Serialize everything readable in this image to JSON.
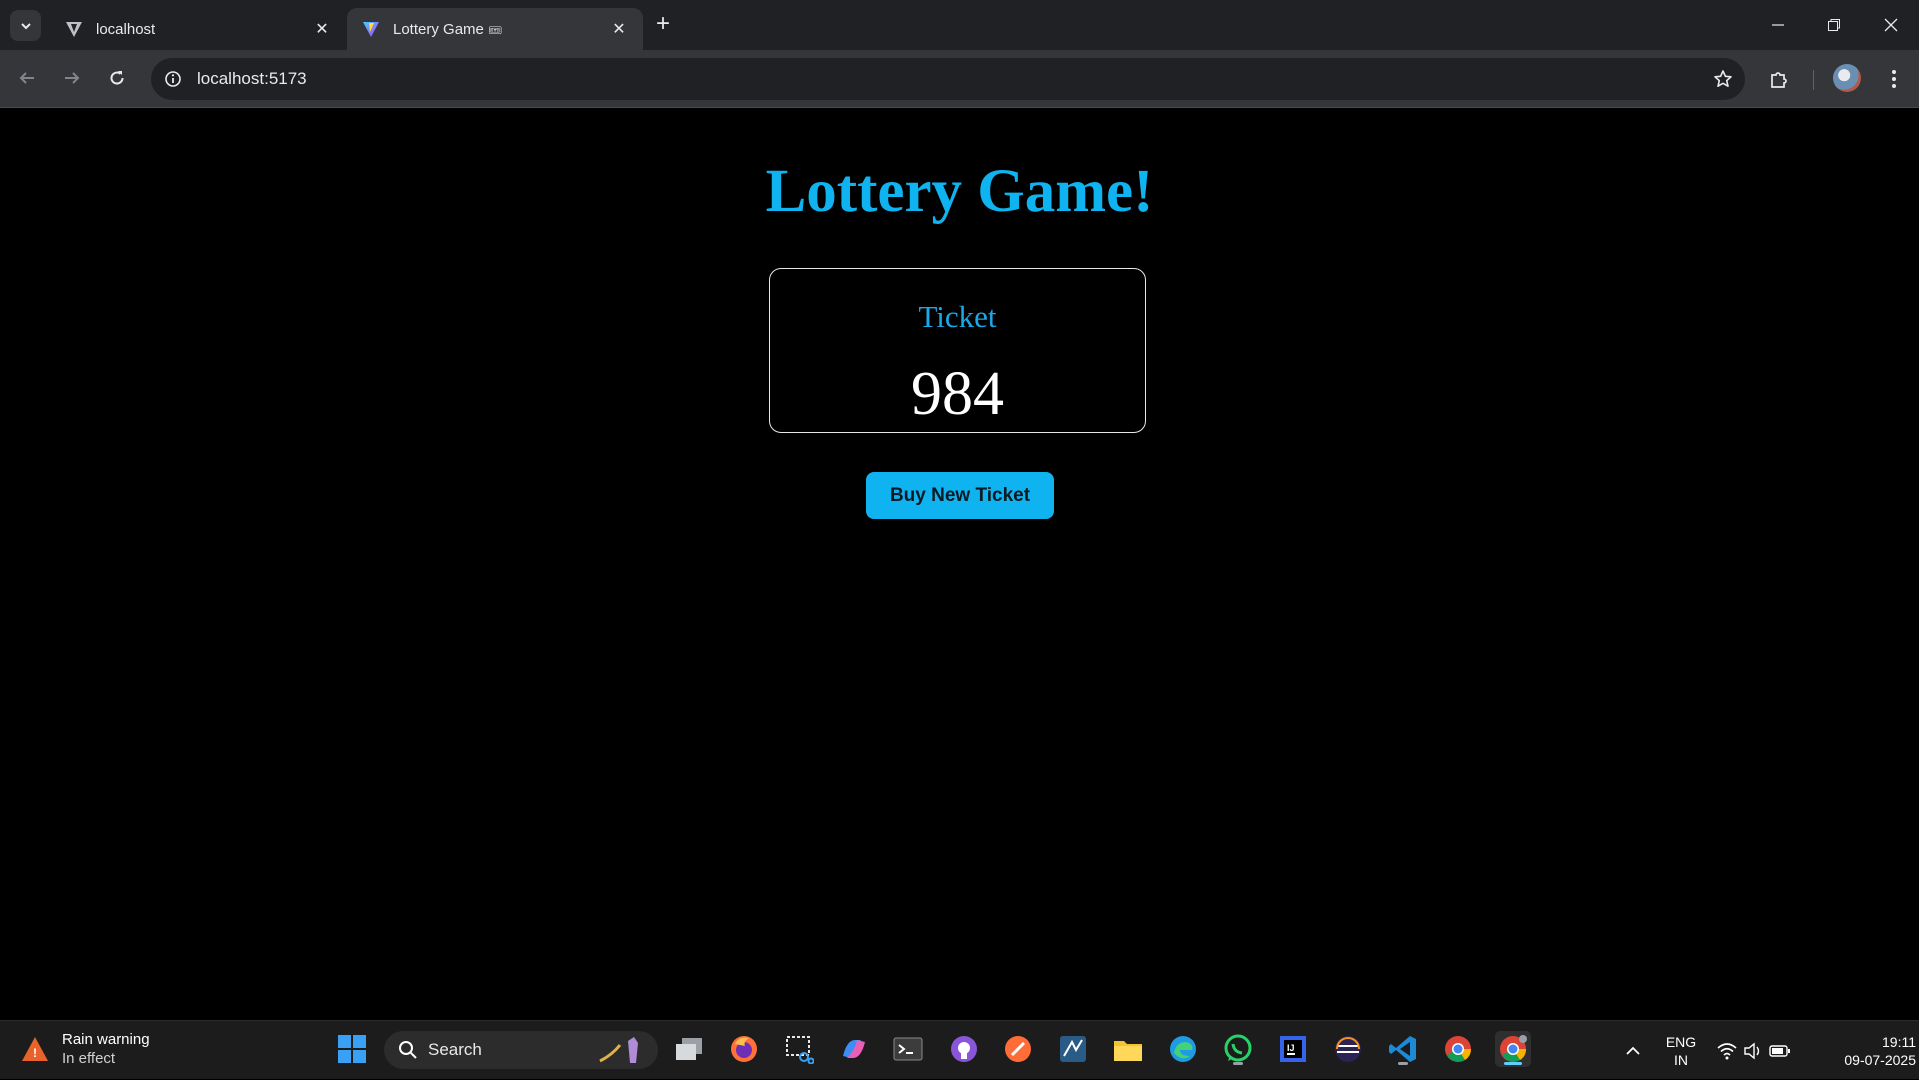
{
  "browser": {
    "tabs": [
      {
        "title": "localhost",
        "active": false,
        "favicon": "vite-icon-gray"
      },
      {
        "title": "Lottery Game",
        "emoji": "🎟",
        "active": true,
        "favicon": "vite-icon"
      }
    ],
    "url": "localhost:5173"
  },
  "page": {
    "heading": "Lottery Game!",
    "ticket_label": "Ticket",
    "ticket_number": "984",
    "buy_button": "Buy New Ticket",
    "colors": {
      "accent": "#0fb3ef",
      "background": "#000000",
      "text": "#ffffff"
    }
  },
  "taskbar": {
    "weather_title": "Rain warning",
    "weather_subtitle": "In effect",
    "search_placeholder": "Search",
    "apps": [
      "windows-start-icon",
      "task-view-icon",
      "firefox-icon",
      "snipping-tool-icon",
      "copilot-icon",
      "terminal-icon",
      "github-desktop-icon",
      "postman-icon",
      "mysql-workbench-icon",
      "file-explorer-icon",
      "edge-icon",
      "whatsapp-icon",
      "intellij-icon",
      "eclipse-icon",
      "vscode-icon",
      "chrome-icon",
      "chrome-profile-icon"
    ],
    "lang_line1": "ENG",
    "lang_line2": "IN",
    "time": "19:11",
    "date": "09-07-2025"
  }
}
